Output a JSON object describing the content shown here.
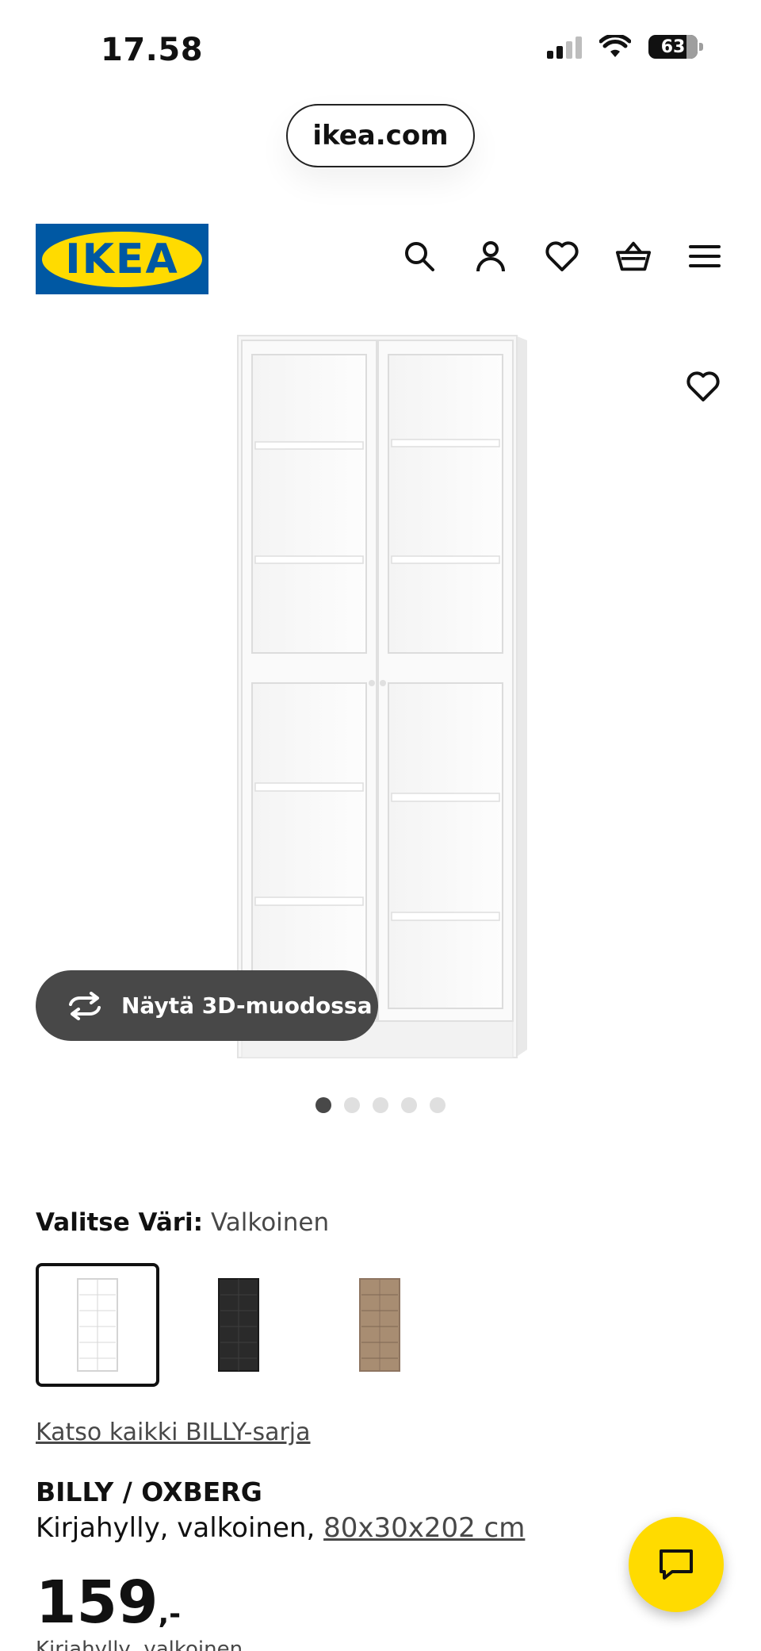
{
  "status_bar": {
    "time": "17.58",
    "battery": "63"
  },
  "browser": {
    "url": "ikea.com"
  },
  "header": {
    "logo_text": "IKEA",
    "icons": [
      "search-icon",
      "account-icon",
      "wishlist-icon",
      "basket-icon",
      "menu-icon"
    ]
  },
  "gallery": {
    "button_3d_label": "Näytä 3D-muodossa",
    "slide_count": 5,
    "active_slide": 1
  },
  "color_selector": {
    "label": "Valitse Väri:",
    "selected_value": "Valkoinen",
    "swatches": [
      {
        "name": "white",
        "color": "#ffffff",
        "selected": true
      },
      {
        "name": "black-brown",
        "color": "#2a2a2a",
        "selected": false
      },
      {
        "name": "oak-effect",
        "color": "#a88d72",
        "selected": false
      }
    ]
  },
  "series_link": "Katso kaikki BILLY-sarja",
  "product": {
    "name": "BILLY / OXBERG",
    "description": "Kirjahylly, valkoinen,",
    "dimensions": "80x30x202 cm",
    "price": "159",
    "price_suffix": ",-"
  },
  "footer_partial": "Kirjahylly, valkoinen",
  "colors": {
    "ikea_blue": "#0058a3",
    "ikea_yellow": "#ffdb00",
    "dark_button": "#484848"
  }
}
